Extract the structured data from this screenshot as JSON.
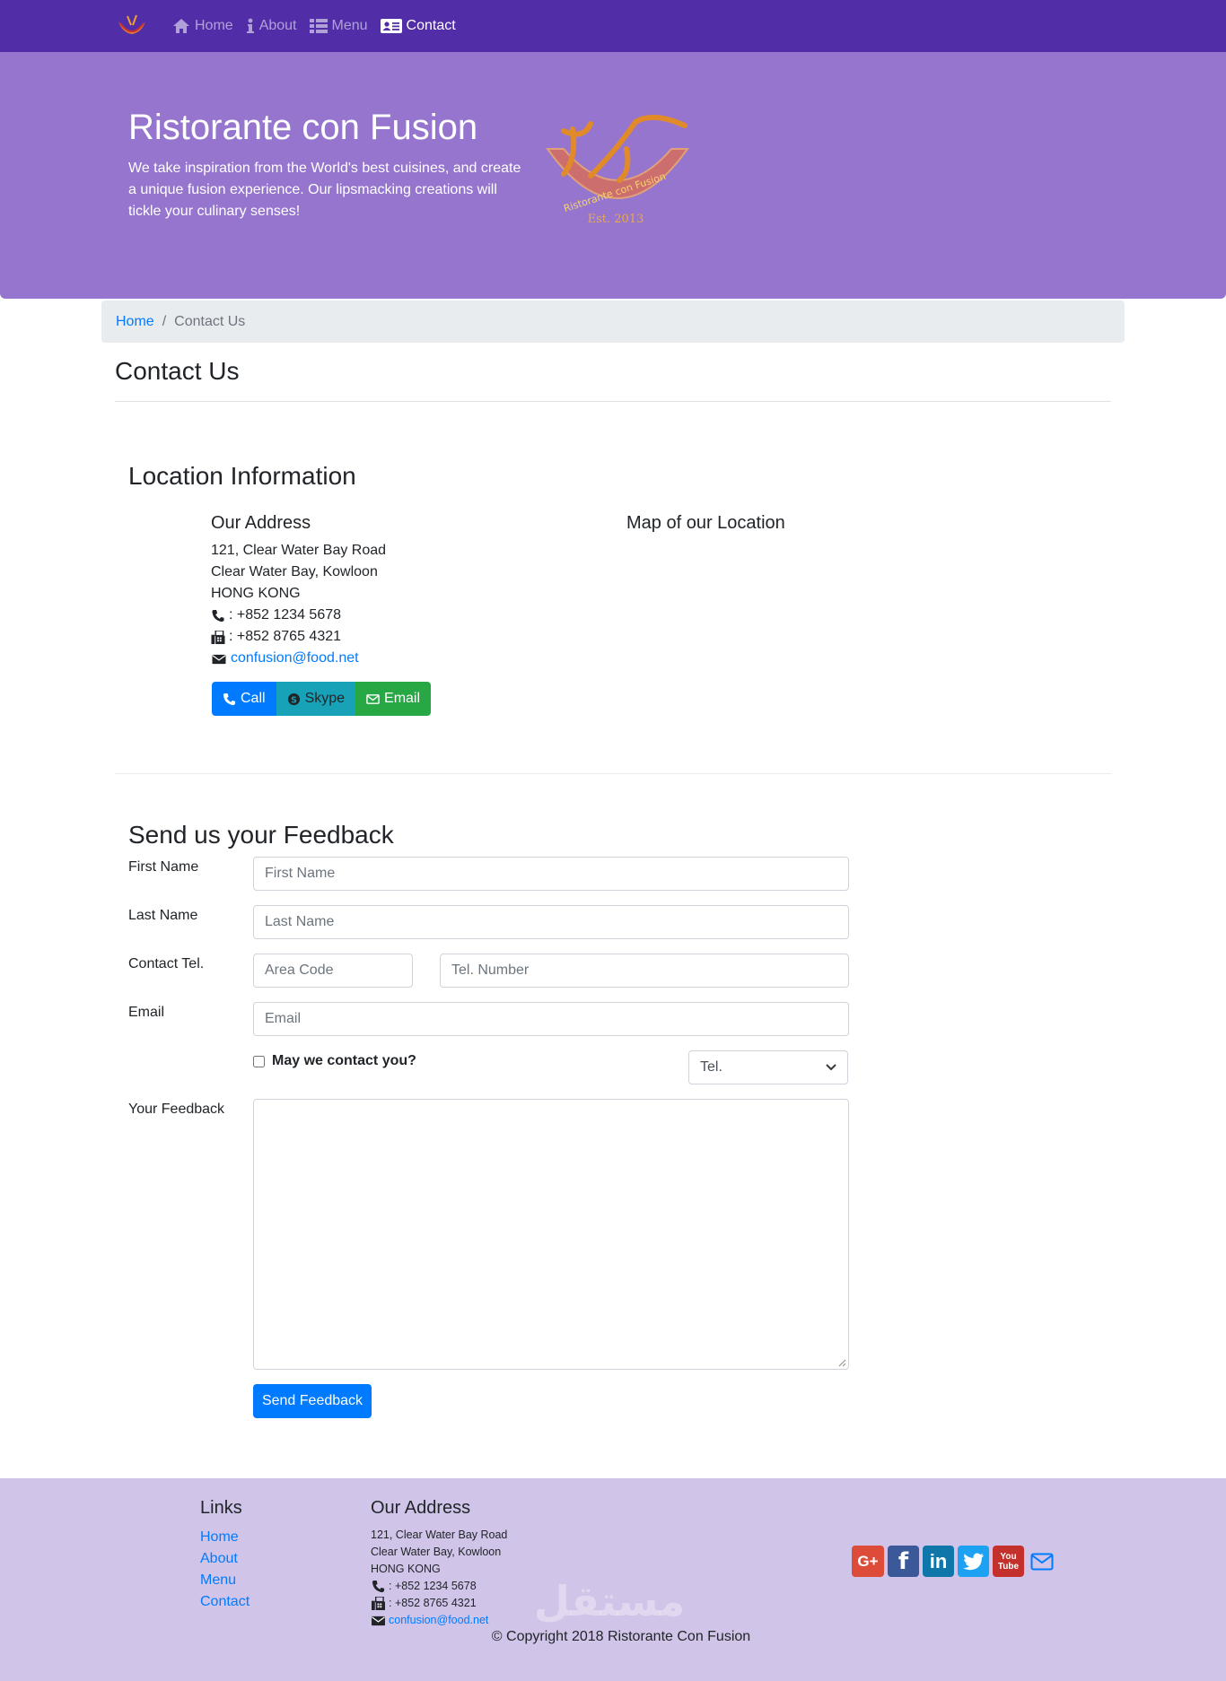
{
  "nav": {
    "items": [
      {
        "label": "Home",
        "icon": "home-icon"
      },
      {
        "label": "About",
        "icon": "info-icon"
      },
      {
        "label": "Menu",
        "icon": "list-icon"
      },
      {
        "label": "Contact",
        "icon": "address-card-icon"
      }
    ],
    "active": "Contact"
  },
  "jumbotron": {
    "title": "Ristorante con Fusion",
    "text": "We take inspiration from the World's best cuisines, and create a unique fusion experience. Our lipsmacking creations will tickle your culinary senses!",
    "logo_text": "Ristorante con Fusion",
    "logo_est": "Est. 2013"
  },
  "breadcrumb": {
    "home": "Home",
    "separator": "/",
    "current": "Contact Us"
  },
  "page_title": "Contact Us",
  "location": {
    "title": "Location Information",
    "address_title": "Our Address",
    "address_lines": [
      "121, Clear Water Bay Road",
      "Clear Water Bay, Kowloon",
      "HONG KONG"
    ],
    "phone": ": +852 1234 5678",
    "fax": ": +852 8765 4321",
    "email": "confusion@food.net",
    "map_title": "Map of our Location",
    "buttons": {
      "call": "Call",
      "skype": "Skype",
      "email": "Email"
    }
  },
  "feedback": {
    "title": "Send us your Feedback",
    "first_name_label": "First Name",
    "first_name_placeholder": "First Name",
    "last_name_label": "Last Name",
    "last_name_placeholder": "Last Name",
    "tel_label": "Contact Tel.",
    "area_code_placeholder": "Area Code",
    "tel_number_placeholder": "Tel. Number",
    "email_label": "Email",
    "email_placeholder": "Email",
    "contact_checkbox_label": "May we contact you?",
    "contact_method_selected": "Tel.",
    "feedback_label": "Your Feedback",
    "submit_label": "Send Feedback"
  },
  "footer": {
    "links_title": "Links",
    "links": [
      "Home",
      "About",
      "Menu",
      "Contact"
    ],
    "address_title": "Our Address",
    "address_lines": [
      "121, Clear Water Bay Road",
      "Clear Water Bay, Kowloon",
      "HONG KONG"
    ],
    "phone": ": +852 1234 5678",
    "fax": ": +852 8765 4321",
    "email": "confusion@food.net",
    "social": [
      "google-plus-icon",
      "facebook-icon",
      "linkedin-icon",
      "twitter-icon",
      "youtube-icon",
      "envelope-icon"
    ],
    "social_labels": {
      "google_plus": "G+",
      "facebook": "f",
      "linkedin": "in",
      "youtube_top": "You",
      "youtube_bottom": "Tube"
    },
    "copyright": "© Copyright 2018 Ristorante Con Fusion",
    "watermark": "مستقل"
  },
  "colors": {
    "navbar": "#512da8",
    "jumbotron": "#9575cd",
    "footer": "#d1c4e9",
    "primary": "#007bff",
    "info": "#17a2b8",
    "success": "#28a745"
  }
}
